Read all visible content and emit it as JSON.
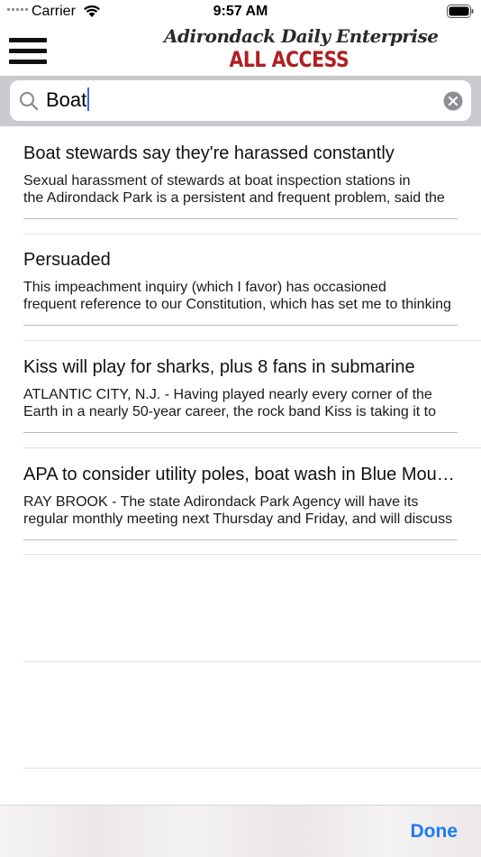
{
  "status_bar": {
    "carrier": "Carrier",
    "time": "9:57 AM"
  },
  "header": {
    "logo_line1": "Adirondack Daily Enterprise",
    "logo_line2": "ALL ACCESS"
  },
  "search": {
    "value": "Boat"
  },
  "results": [
    {
      "title": "Boat stewards say they're harassed constantly",
      "summary_line1": "Sexual harassment of stewards at boat inspection stations in",
      "summary_line2": "the Adirondack Park is a persistent and frequent problem, said the"
    },
    {
      "title": "Persuaded",
      "summary_line1": "This impeachment inquiry (which I favor) has occasioned",
      "summary_line2": "frequent reference to our Constitution, which has set me to thinking"
    },
    {
      "title": "Kiss will play for sharks, plus 8 fans in submarine",
      "summary_line1": "ATLANTIC CITY, N.J. - Having played nearly every corner of the",
      "summary_line2": "Earth in a nearly 50-year career, the rock band Kiss is taking it to"
    },
    {
      "title": "APA to consider utility poles, boat wash in Blue Mountain Lake",
      "summary_line1": "RAY BROOK - The state Adirondack Park Agency will have its",
      "summary_line2": "regular monthly meeting next Thursday and Friday, and will discuss"
    }
  ],
  "toolbar": {
    "done_label": "Done"
  },
  "colors": {
    "accent": "#1b7cf2",
    "logo_red": "#b01f24",
    "search_bg": "#c9c9ce"
  }
}
